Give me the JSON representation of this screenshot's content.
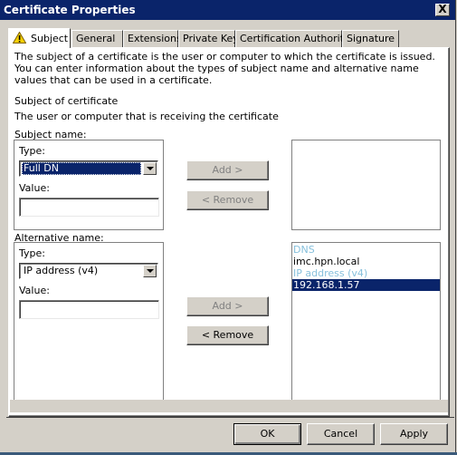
{
  "window": {
    "title": "Certificate Properties",
    "close_label": "X"
  },
  "tabs": [
    {
      "label": "Subject",
      "active": true,
      "icon": "warning-icon"
    },
    {
      "label": "General"
    },
    {
      "label": "Extensions"
    },
    {
      "label": "Private Key"
    },
    {
      "label": "Certification Authority"
    },
    {
      "label": "Signature"
    }
  ],
  "subject_tab": {
    "description": "The subject of a certificate is the user or computer to which the certificate is issued. You can enter information about the types of subject name and alternative name values that can be used in a certificate.",
    "section_title": "Subject of certificate",
    "section_desc": "The user or computer that is receiving the certificate",
    "subject_name": {
      "label": "Subject name:",
      "type_label": "Type:",
      "type_value": "Full DN",
      "value_label": "Value:",
      "value": "",
      "add_label": "Add >",
      "remove_label": "< Remove",
      "list": []
    },
    "alternative_name": {
      "label": "Alternative name:",
      "type_label": "Type:",
      "type_value": "IP address (v4)",
      "value_label": "Value:",
      "value": "",
      "add_label": "Add >",
      "remove_label": "< Remove",
      "list": [
        {
          "text": "DNS",
          "kind": "header"
        },
        {
          "text": "imc.hpn.local",
          "kind": "item"
        },
        {
          "text": "IP address (v4)",
          "kind": "header"
        },
        {
          "text": "192.168.1.57",
          "kind": "item",
          "selected": true
        }
      ]
    }
  },
  "footer": {
    "ok_label": "OK",
    "cancel_label": "Cancel",
    "apply_label": "Apply"
  }
}
